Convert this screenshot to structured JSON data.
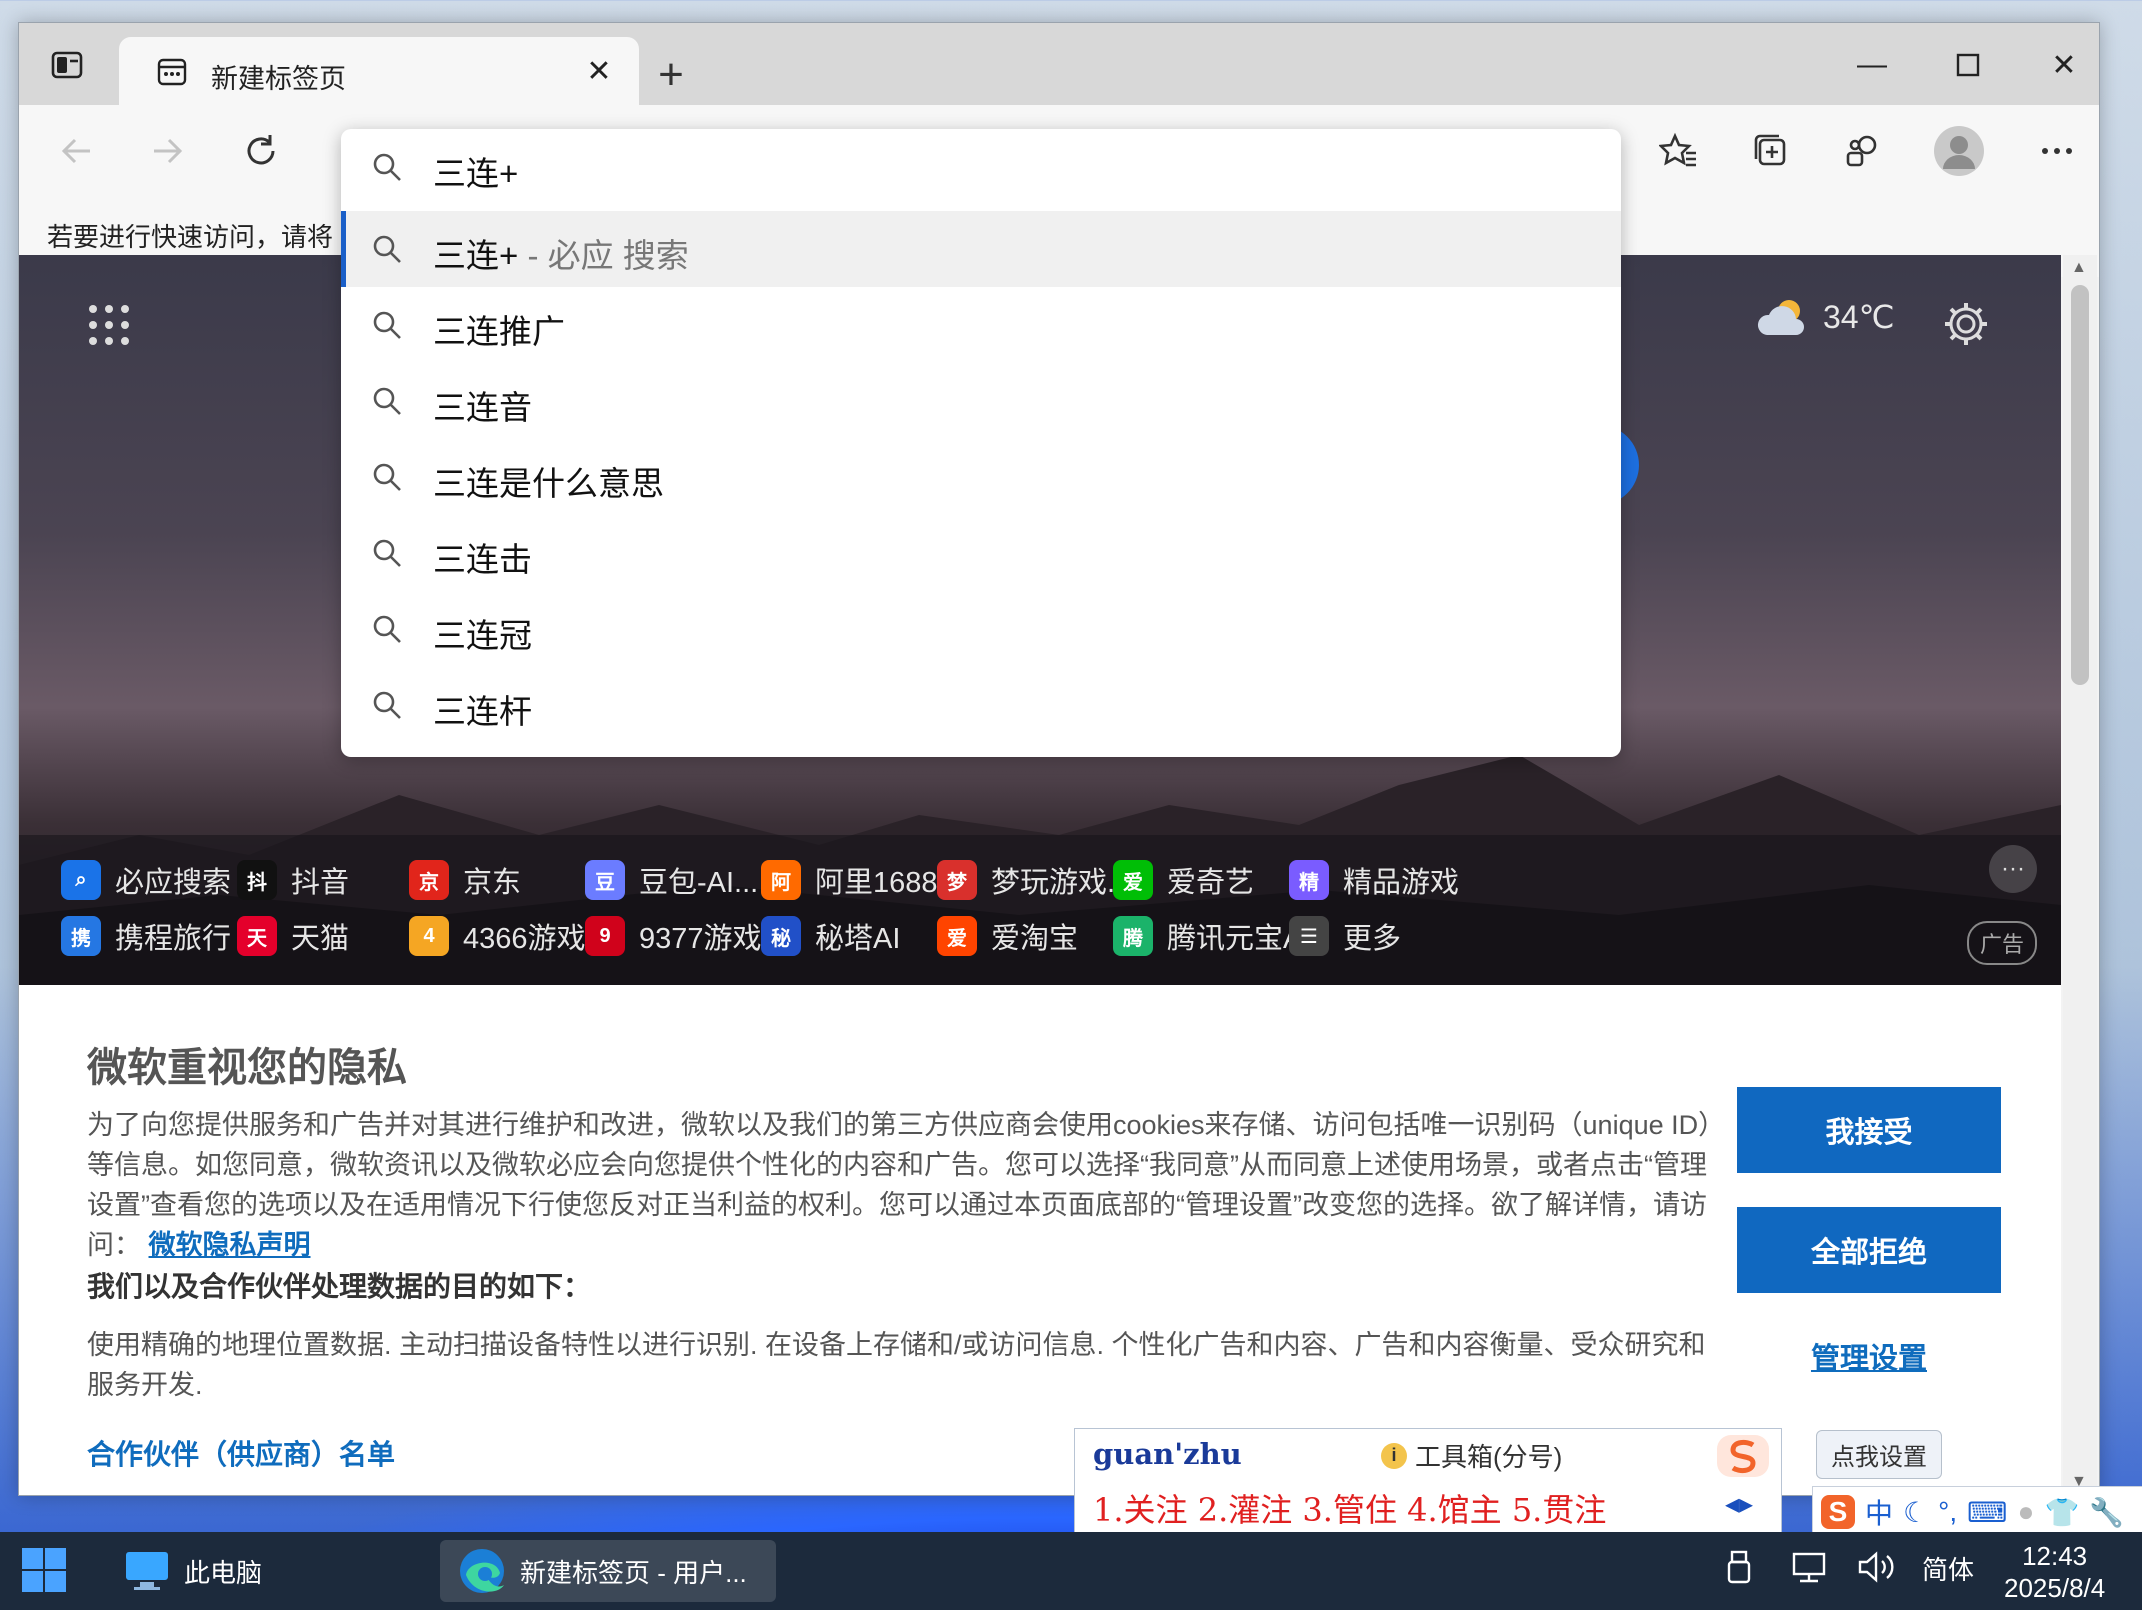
{
  "browser": {
    "tab_title": "新建标签页",
    "favorites_hint": "若要进行快速访问，请将"
  },
  "omnibox": {
    "query": "三连+",
    "suggestions": [
      {
        "text": "三连+",
        "suffix": " - 必应 搜索",
        "selected": true
      },
      {
        "text": "三连推广"
      },
      {
        "text": "三连音"
      },
      {
        "text": "三连是什么意思"
      },
      {
        "text": "三连击"
      },
      {
        "text": "三连冠"
      },
      {
        "text": "三连杆"
      }
    ]
  },
  "newtab": {
    "weather_temp": "34℃",
    "tiles_row1": [
      {
        "label": "必应搜索",
        "icon": "bing-search-icon",
        "color": "#1a73e8"
      },
      {
        "label": "抖音",
        "icon": "douyin-icon",
        "color": "#111111"
      },
      {
        "label": "京东",
        "icon": "jd-icon",
        "color": "#e1251b"
      },
      {
        "label": "豆包-AI...",
        "icon": "doubao-icon",
        "color": "#6b7cff"
      },
      {
        "label": "阿里1688",
        "icon": "ali1688-icon",
        "color": "#ff6a00"
      },
      {
        "label": "梦玩游戏...",
        "icon": "mengwan-icon",
        "color": "#d9302c"
      },
      {
        "label": "爱奇艺",
        "icon": "iqiyi-icon",
        "color": "#00be06"
      },
      {
        "label": "精品游戏",
        "icon": "gamepad-icon",
        "color": "#7a5cff"
      }
    ],
    "tiles_row2": [
      {
        "label": "携程旅行",
        "icon": "ctrip-icon",
        "color": "#2577e3"
      },
      {
        "label": "天猫",
        "icon": "tmall-icon",
        "color": "#e4002b"
      },
      {
        "label": "4366游戏",
        "icon": "game4366-icon",
        "color": "#f5a623"
      },
      {
        "label": "9377游戏",
        "icon": "game9377-icon",
        "color": "#d0021b"
      },
      {
        "label": "秘塔AI",
        "icon": "metaso-icon",
        "color": "#2150c8"
      },
      {
        "label": "爱淘宝",
        "icon": "taobao-icon",
        "color": "#ff4400"
      },
      {
        "label": "腾讯元宝AI",
        "icon": "yuanbao-icon",
        "color": "#1bb36a"
      },
      {
        "label": "更多",
        "icon": "menu-icon",
        "color": "#444444"
      }
    ],
    "ad_label": "广告"
  },
  "privacy": {
    "heading": "微软重视您的隐私",
    "body": "为了向您提供服务和广告并对其进行维护和改进，微软以及我们的第三方供应商会使用cookies来存储、访问包括唯一识别码（unique ID）等信息。如您同意，微软资讯以及微软必应会向您提供个性化的内容和广告。您可以选择“我同意”从而同意上述使用场景，或者点击“管理设置”查看您的选项以及在适用情况下行使您反对正当利益的权利。您可以通过本页面底部的“管理设置”改变您的选择。欲了解详情，请访问：",
    "link": "微软隐私声明",
    "purpose_title": "我们以及合作伙伴处理数据的目的如下：",
    "purposes": "使用精确的地理位置数据. 主动扫描设备特性以进行识别. 在设备上存储和/或访问信息. 个性化广告和内容、广告和内容衡量、受众研究和服务开发.",
    "partners_link": "合作伙伴（供应商）名单",
    "accept_btn": "我接受",
    "reject_btn": "全部拒绝",
    "manage_link": "管理设置"
  },
  "ime": {
    "pinyin": "guan'zhu",
    "toolbox": "工具箱(分号)",
    "candidates": "1.关注  2.灌注  3.管住  4.馆主  5.贯注",
    "tip": "点我设置",
    "mode": "中"
  },
  "taskbar": {
    "this_pc": "此电脑",
    "edge_window": "新建标签页 - 用户...",
    "ime_lang": "简体",
    "time": "12:43",
    "date": "2025/8/4"
  }
}
